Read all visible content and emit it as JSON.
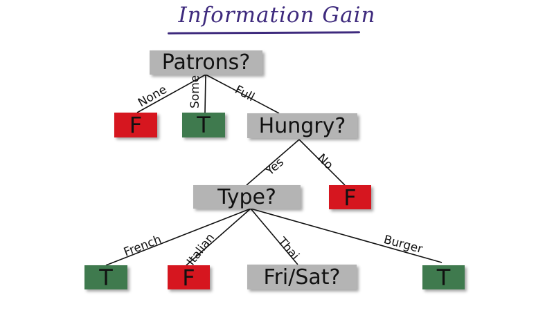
{
  "title": "Information Gain",
  "nodes": {
    "patrons": "Patrons?",
    "hungry": "Hungry?",
    "type": "Type?",
    "frisat": "Fri/Sat?",
    "leaf_none": "F",
    "leaf_some": "T",
    "leaf_no": "F",
    "leaf_french": "T",
    "leaf_italian": "F",
    "leaf_burger": "T"
  },
  "edges": {
    "none": "None",
    "some": "Some",
    "full": "Full",
    "yes": "Yes",
    "no": "No",
    "french": "French",
    "italian": "Italian",
    "thai": "Thai",
    "burger": "Burger"
  },
  "colors": {
    "true_leaf": "#3f7a4e",
    "false_leaf": "#d6161f",
    "attribute_node": "#b4b4b4",
    "title": "#3e2a7d"
  }
}
